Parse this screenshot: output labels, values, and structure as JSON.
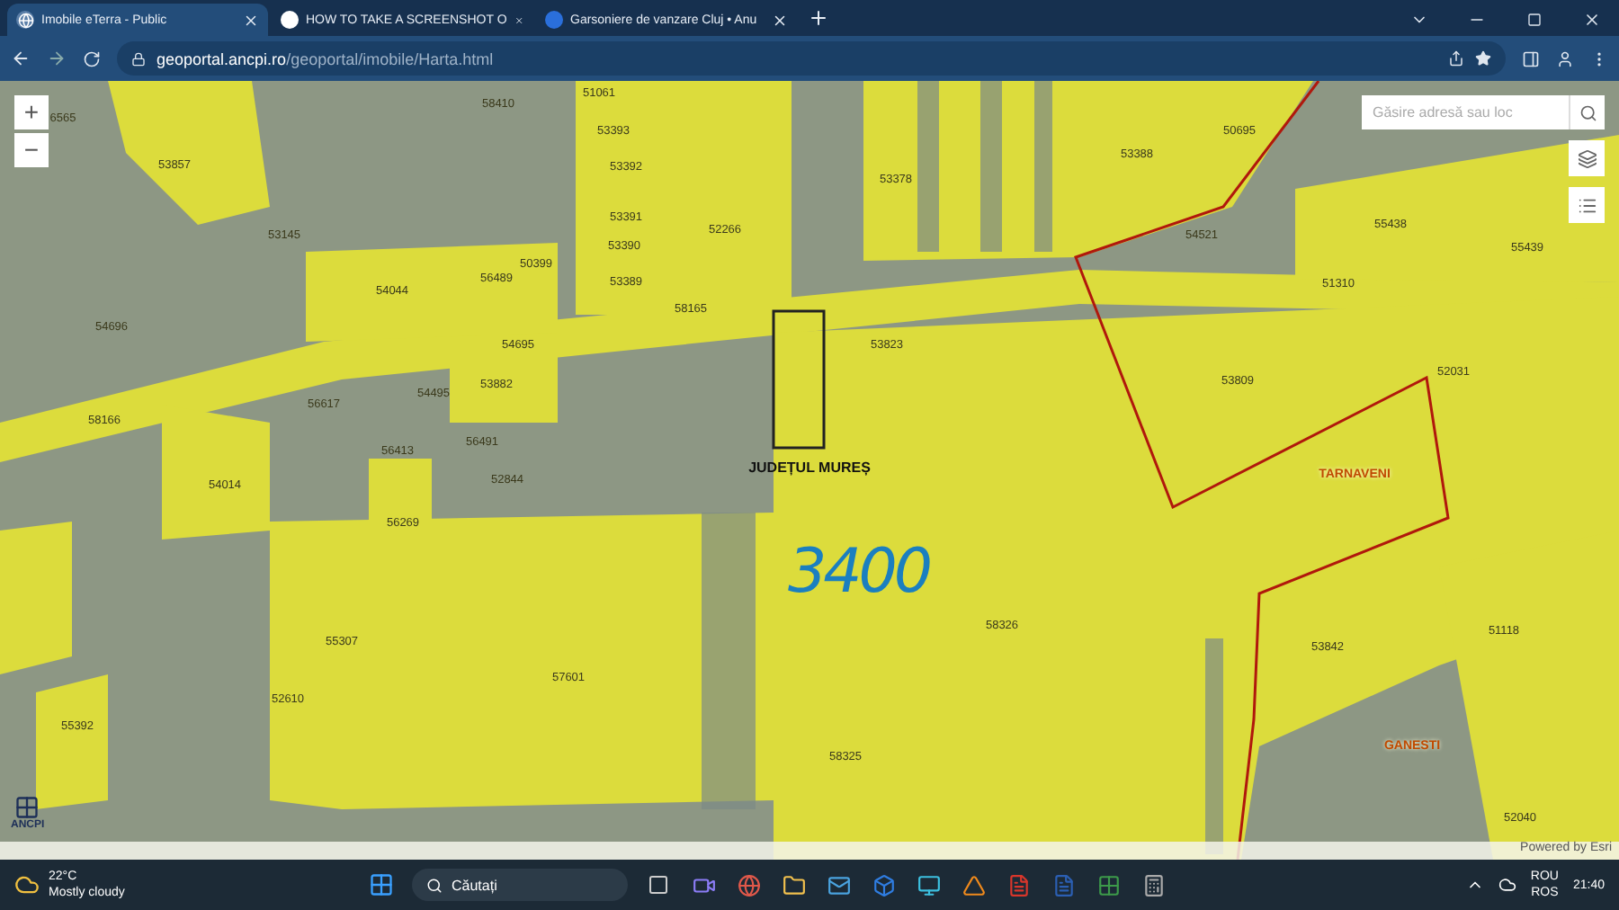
{
  "browser": {
    "tabs": [
      {
        "title": "Imobile eTerra - Public",
        "selected": true
      },
      {
        "title": "HOW TO TAKE A SCREENSHOT O",
        "selected": false
      },
      {
        "title": "Garsoniere de vanzare Cluj • Anu",
        "selected": false
      }
    ],
    "address": {
      "host": "geoportal.ancpi.ro",
      "path": "/geoportal/imobile/Harta.html"
    }
  },
  "map": {
    "zoom_in": "+",
    "zoom_out": "−",
    "search": {
      "placeholder": "Găsire adresă sau loc"
    },
    "parcels": [
      "6565",
      "53857",
      "58410",
      "51061",
      "53393",
      "53392",
      "53391",
      "53390",
      "53389",
      "52266",
      "53378",
      "53388",
      "50695",
      "54521",
      "55438",
      "55439",
      "51310",
      "53145",
      "54044",
      "56489",
      "50399",
      "58165",
      "54696",
      "54695",
      "53823",
      "53809",
      "52031",
      "53882",
      "54495",
      "56617",
      "58166",
      "56491",
      "56413",
      "52844",
      "54014",
      "56269",
      "55307",
      "52610",
      "57601",
      "55392",
      "58326",
      "58325",
      "53842",
      "51118",
      "52040"
    ],
    "places": [
      {
        "name": "JUDEȚUL MUREȘ",
        "kind": "county"
      },
      {
        "name": "TARNAVENI",
        "kind": "town"
      },
      {
        "name": "GANESTI",
        "kind": "town"
      }
    ],
    "annotation": "3400",
    "logo": "ANCPI",
    "attribution": "Powered by Esri"
  },
  "taskbar": {
    "temperature": "22°C",
    "weather": "Mostly cloudy",
    "search": "Căutați",
    "lang_top": "ROU",
    "lang_bottom": "ROS",
    "time": "21:40"
  }
}
